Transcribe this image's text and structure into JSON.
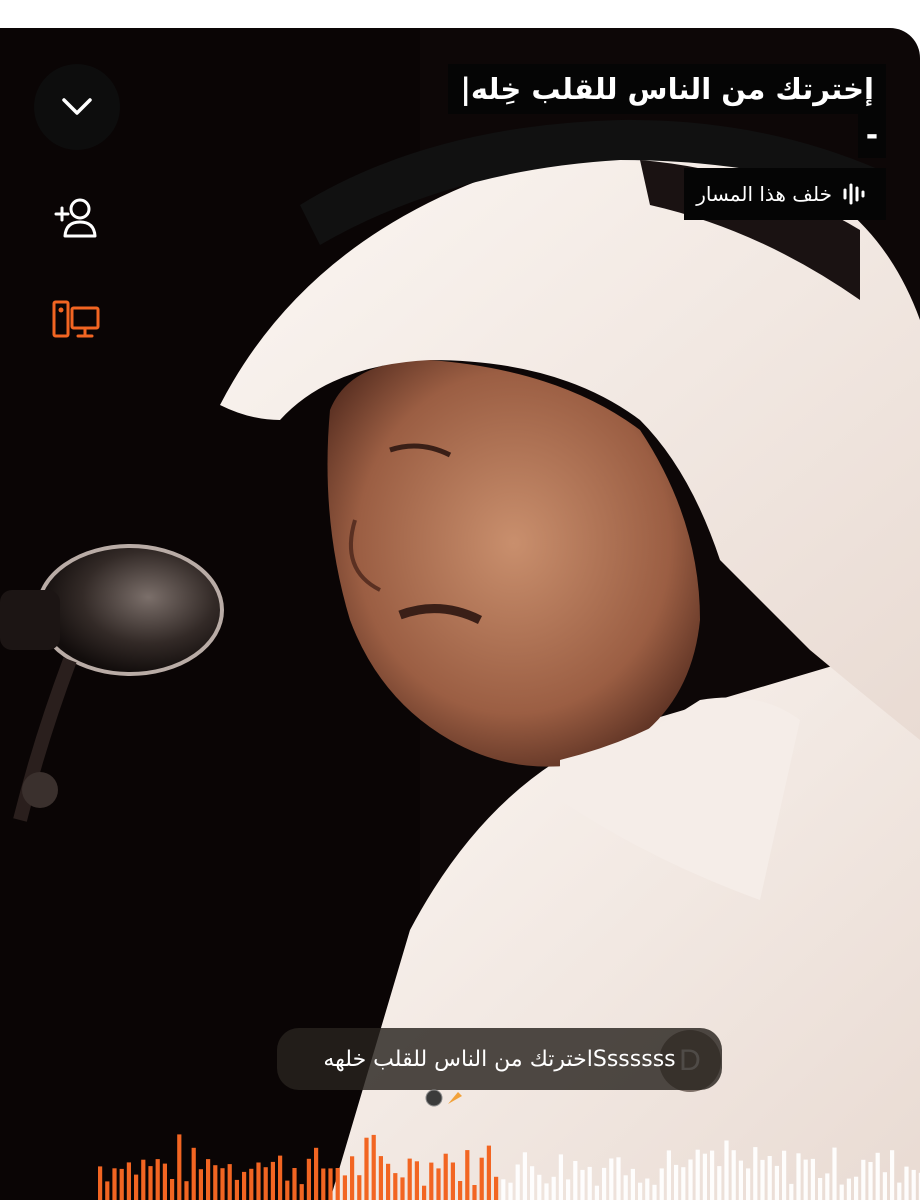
{
  "player": {
    "track_title": "إخترتك من الناس للقلب خِله|",
    "artist": "-",
    "behind_track_label": "خلف هذا المسار"
  },
  "controls": {
    "collapse_icon": "chevron-down-icon",
    "follow_icon": "add-user-icon",
    "cast_icon": "devices-icon"
  },
  "comment": {
    "avatar_letter": "D",
    "text": "اخترتك من الناس للقلب خلههSssssss"
  },
  "waveform": {
    "played_color": "#f26522",
    "unplayed_color": "#ffffff",
    "progress": 0.49
  },
  "colors": {
    "accent": "#f26522",
    "icon_inactive": "#ffffff"
  }
}
